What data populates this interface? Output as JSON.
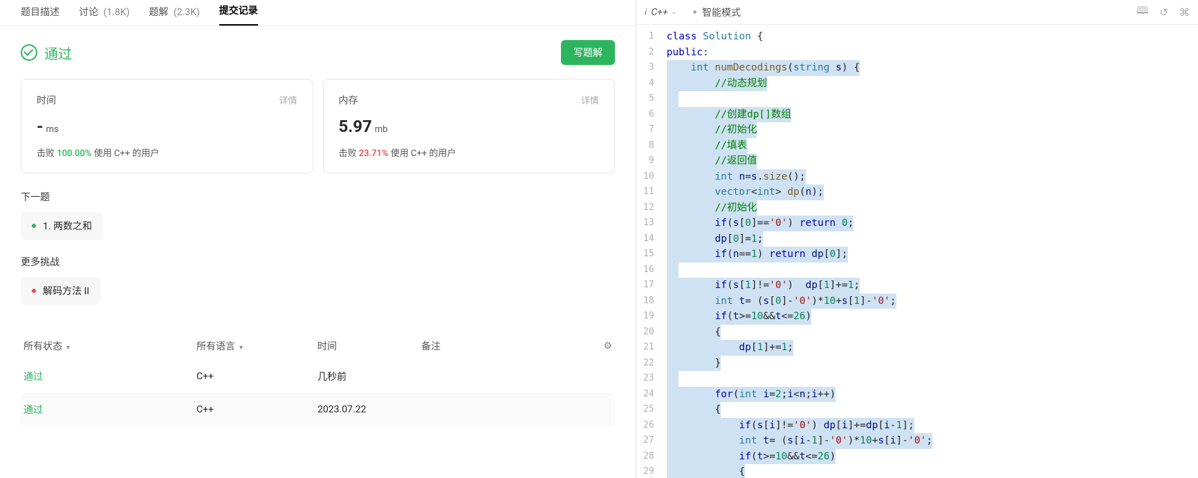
{
  "tabs": {
    "desc": "题目描述",
    "discuss": "讨论",
    "discuss_count": "(1.8K)",
    "solution": "题解",
    "solution_count": "(2.3K)",
    "submissions": "提交记录"
  },
  "status": {
    "label": "通过",
    "write_btn": "写题解"
  },
  "metrics": {
    "time": {
      "title": "时间",
      "detail": "详情",
      "value": "-",
      "unit": "ms",
      "beat_prefix": "击败",
      "beat_pct": "100.00%",
      "beat_suffix": "使用 C++ 的用户"
    },
    "memory": {
      "title": "内存",
      "detail": "详情",
      "value": "5.97",
      "unit": "mb",
      "beat_prefix": "击败",
      "beat_pct": "23.71%",
      "beat_suffix": "使用 C++ 的用户"
    }
  },
  "next_q": {
    "label": "下一题",
    "item": "1. 两数之和"
  },
  "more": {
    "label": "更多挑战",
    "item": "解码方法 II"
  },
  "table": {
    "cols": {
      "status": "所有状态",
      "lang": "所有语言",
      "time": "时间",
      "note": "备注"
    },
    "rows": [
      {
        "status": "通过",
        "lang": "C++",
        "time": "几秒前"
      },
      {
        "status": "通过",
        "lang": "C++",
        "time": "2023.07.22"
      }
    ]
  },
  "editor_bar": {
    "lang": "C++",
    "mode": "智能模式"
  },
  "code_lines": [
    {
      "html": "<span class='tk-keyword'>class</span> <span class='tk-type'>Solution</span> {",
      "selected": false,
      "indent": 0
    },
    {
      "html": "<span class='tk-keyword'>public</span>:",
      "selected": false,
      "indent": 0
    },
    {
      "html": "<span class='tk-type'>int</span> <span class='tk-func'>numDecodings</span>(<span class='tk-type'>string</span> <span class='tk-ident'>s</span>) {",
      "selected": true,
      "indent": 1
    },
    {
      "html": "<span class='tk-comment'>//动态规划</span>",
      "selected": true,
      "indent": 2
    },
    {
      "html": "",
      "selected": true,
      "indent": 2,
      "blank": true
    },
    {
      "html": "<span class='tk-comment'>//创建dp[]数组</span>",
      "selected": true,
      "indent": 2
    },
    {
      "html": "<span class='tk-comment'>//初始化</span>",
      "selected": true,
      "indent": 2
    },
    {
      "html": "<span class='tk-comment'>//填表</span>",
      "selected": true,
      "indent": 2
    },
    {
      "html": "<span class='tk-comment'>//返回值</span>",
      "selected": true,
      "indent": 2
    },
    {
      "html": "<span class='tk-type'>int</span> <span class='tk-ident'>n</span>=<span class='tk-ident'>s</span>.<span class='tk-func'>size</span>();",
      "selected": true,
      "indent": 2
    },
    {
      "html": "<span class='tk-type'>vector</span>&lt;<span class='tk-type'>int</span>&gt; <span class='tk-func'>dp</span>(<span class='tk-ident'>n</span>);",
      "selected": true,
      "indent": 2
    },
    {
      "html": "<span class='tk-comment'>//初始化</span>",
      "selected": true,
      "indent": 2
    },
    {
      "html": "<span class='tk-keyword'>if</span>(<span class='tk-ident'>s</span>[<span class='tk-num'>0</span>]==<span class='tk-string'>'0'</span>) <span class='tk-keyword'>return</span> <span class='tk-num'>0</span>;",
      "selected": true,
      "indent": 2
    },
    {
      "html": "<span class='tk-ident'>dp</span>[<span class='tk-num'>0</span>]=<span class='tk-num'>1</span>;",
      "selected": true,
      "indent": 2
    },
    {
      "html": "<span class='tk-keyword'>if</span>(<span class='tk-ident'>n</span>==<span class='tk-num'>1</span>) <span class='tk-keyword'>return</span> <span class='tk-ident'>dp</span>[<span class='tk-num'>0</span>];",
      "selected": true,
      "indent": 2
    },
    {
      "html": "",
      "selected": true,
      "indent": 2,
      "blank": true
    },
    {
      "html": "<span class='tk-keyword'>if</span>(<span class='tk-ident'>s</span>[<span class='tk-num'>1</span>]!=<span class='tk-string'>'0'</span>)  <span class='tk-ident'>dp</span>[<span class='tk-num'>1</span>]+=<span class='tk-num'>1</span>;",
      "selected": true,
      "indent": 2
    },
    {
      "html": "<span class='tk-type'>int</span> <span class='tk-ident'>t</span>= (<span class='tk-ident'>s</span>[<span class='tk-num'>0</span>]-<span class='tk-string'>'0'</span>)*<span class='tk-num'>10</span>+<span class='tk-ident'>s</span>[<span class='tk-num'>1</span>]-<span class='tk-string'>'0'</span>;",
      "selected": true,
      "indent": 2
    },
    {
      "html": "<span class='tk-keyword'>if</span>(<span class='tk-ident'>t</span>&gt;=<span class='tk-num'>10</span>&amp;&amp;<span class='tk-ident'>t</span>&lt;=<span class='tk-num'>26</span>)",
      "selected": true,
      "indent": 2
    },
    {
      "html": "{",
      "selected": true,
      "indent": 2
    },
    {
      "html": "<span class='tk-ident'>dp</span>[<span class='tk-num'>1</span>]+=<span class='tk-num'>1</span>;",
      "selected": true,
      "indent": 3
    },
    {
      "html": "}",
      "selected": true,
      "indent": 2
    },
    {
      "html": "",
      "selected": true,
      "indent": 2,
      "blank": true
    },
    {
      "html": "<span class='tk-keyword'>for</span>(<span class='tk-type'>int</span> <span class='tk-ident'>i</span>=<span class='tk-num'>2</span>;<span class='tk-ident'>i</span>&lt;<span class='tk-ident'>n</span>;<span class='tk-ident'>i</span>++)",
      "selected": true,
      "indent": 2
    },
    {
      "html": "{",
      "selected": true,
      "indent": 2
    },
    {
      "html": "<span class='tk-keyword'>if</span>(<span class='tk-ident'>s</span>[<span class='tk-ident'>i</span>]!=<span class='tk-string'>'0'</span>) <span class='tk-ident'>dp</span>[<span class='tk-ident'>i</span>]+=<span class='tk-ident'>dp</span>[<span class='tk-ident'>i</span>-<span class='tk-num'>1</span>];",
      "selected": true,
      "indent": 3
    },
    {
      "html": "<span class='tk-type'>int</span> <span class='tk-ident'>t</span>= (<span class='tk-ident'>s</span>[<span class='tk-ident'>i</span>-<span class='tk-num'>1</span>]-<span class='tk-string'>'0'</span>)*<span class='tk-num'>10</span>+<span class='tk-ident'>s</span>[<span class='tk-ident'>i</span>]-<span class='tk-string'>'0'</span>;",
      "selected": true,
      "indent": 3
    },
    {
      "html": "<span class='tk-keyword'>if</span>(<span class='tk-ident'>t</span>&gt;=<span class='tk-num'>10</span>&amp;&amp;<span class='tk-ident'>t</span>&lt;=<span class='tk-num'>26</span>)",
      "selected": true,
      "indent": 3
    },
    {
      "html": "{",
      "selected": true,
      "indent": 3
    }
  ]
}
